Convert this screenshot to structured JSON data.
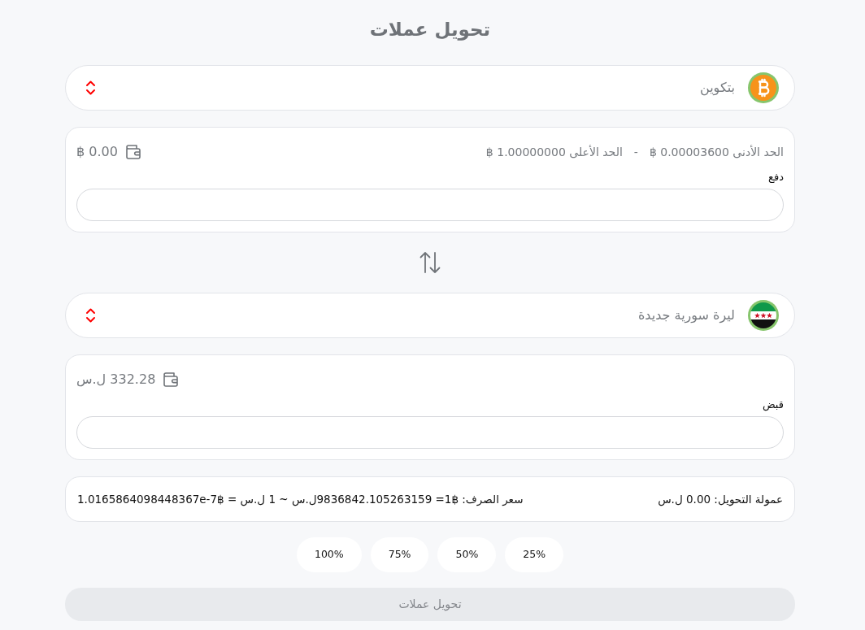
{
  "title": "تحويل عملات",
  "pay_currency": {
    "name": "بتكوين"
  },
  "pay": {
    "min_limit": "الحد الأدنى 0.00003600 ฿",
    "separator": "-",
    "max_limit": "الحد الأعلى 1.00000000 ฿",
    "balance": "0.00 ฿",
    "label": "دفع"
  },
  "receive_currency": {
    "name": "ليرة سورية جديدة"
  },
  "receive": {
    "balance": "332.28 ل.س",
    "label": "قبض"
  },
  "summary": {
    "fee": "عمولة التحويل: 0.00 ل.س",
    "rate": "سعر الصرف: ฿1= 9836842.105263159ل.س ~ 1 ل.س = ฿1.0165864098448367e-7"
  },
  "percent_buttons": [
    "25%",
    "50%",
    "75%",
    "100%"
  ],
  "submit": {
    "label": "تحويل عملات",
    "disabled": true
  }
}
